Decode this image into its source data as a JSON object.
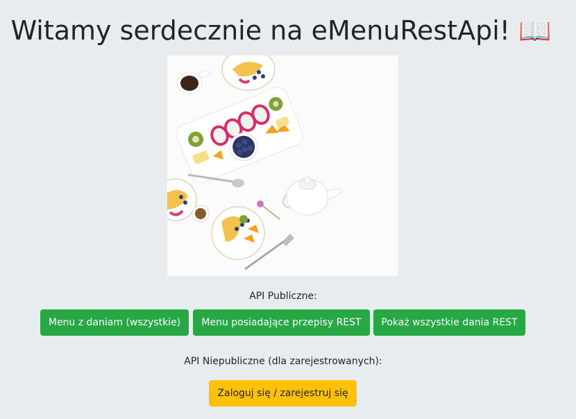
{
  "header": {
    "title": "Witamy serdecznie na eMenuRestApi! 📖"
  },
  "hero_image": {
    "icon": "food-platter-photo"
  },
  "public_api": {
    "label": "API Publiczne:",
    "buttons": [
      {
        "label": "Menu z daniam (wszystkie)"
      },
      {
        "label": "Menu posiadające przepisy REST"
      },
      {
        "label": "Pokaż wszystkie dania REST"
      }
    ]
  },
  "private_api": {
    "label": "API Niepubliczne (dla zarejestrowanych):",
    "login_button": "Zaloguj się / zarejestruj się"
  },
  "colors": {
    "background": "#e9ecef",
    "success": "#28a745",
    "warning": "#ffc107"
  }
}
